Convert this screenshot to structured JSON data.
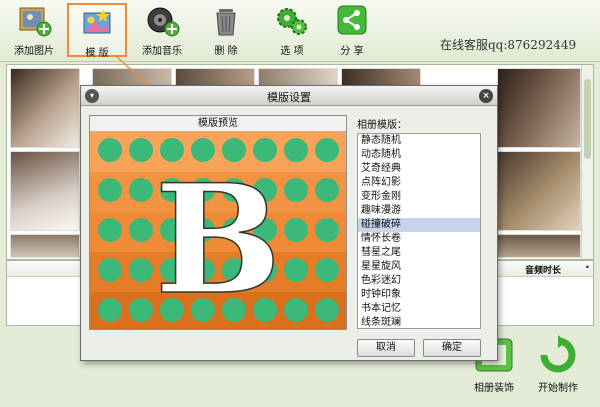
{
  "toolbar": {
    "items": [
      {
        "label": "添加图片",
        "icon": "add-picture-icon"
      },
      {
        "label": "模 版",
        "icon": "template-icon"
      },
      {
        "label": "添加音乐",
        "icon": "add-music-icon"
      },
      {
        "label": "删 除",
        "icon": "trash-icon"
      },
      {
        "label": "选 项",
        "icon": "gears-icon"
      },
      {
        "label": "分 享",
        "icon": "share-icon"
      }
    ],
    "service_text": "在线客服qq:876292449",
    "active_color": "#f08a3a"
  },
  "music_table": {
    "columns": [
      "音频时长",
      "•"
    ]
  },
  "bottom": {
    "decorate_label": "相册装饰",
    "start_label": "开始制作"
  },
  "dialog": {
    "title": "模版设置",
    "preview_title": "模版预览",
    "list_label": "相册模版：",
    "templates": [
      "静态随机",
      "动态随机",
      "艾奇经典",
      "点阵幻影",
      "变形金刚",
      "趣味漫游",
      "碰撞破碎",
      "情怀长卷",
      "彗星之尾",
      "星星旋风",
      "色彩迷幻",
      "时钟印象",
      "书本记忆",
      "线条斑斓"
    ],
    "selected_index": 6,
    "preview_letter": "B",
    "cancel_label": "取消",
    "ok_label": "确定"
  },
  "colors": {
    "toolbar_bg": "#e1ead3",
    "preview_orange": "#f28a2c",
    "preview_dot": "#3cb878",
    "selected_row": "#c6d4ee"
  }
}
